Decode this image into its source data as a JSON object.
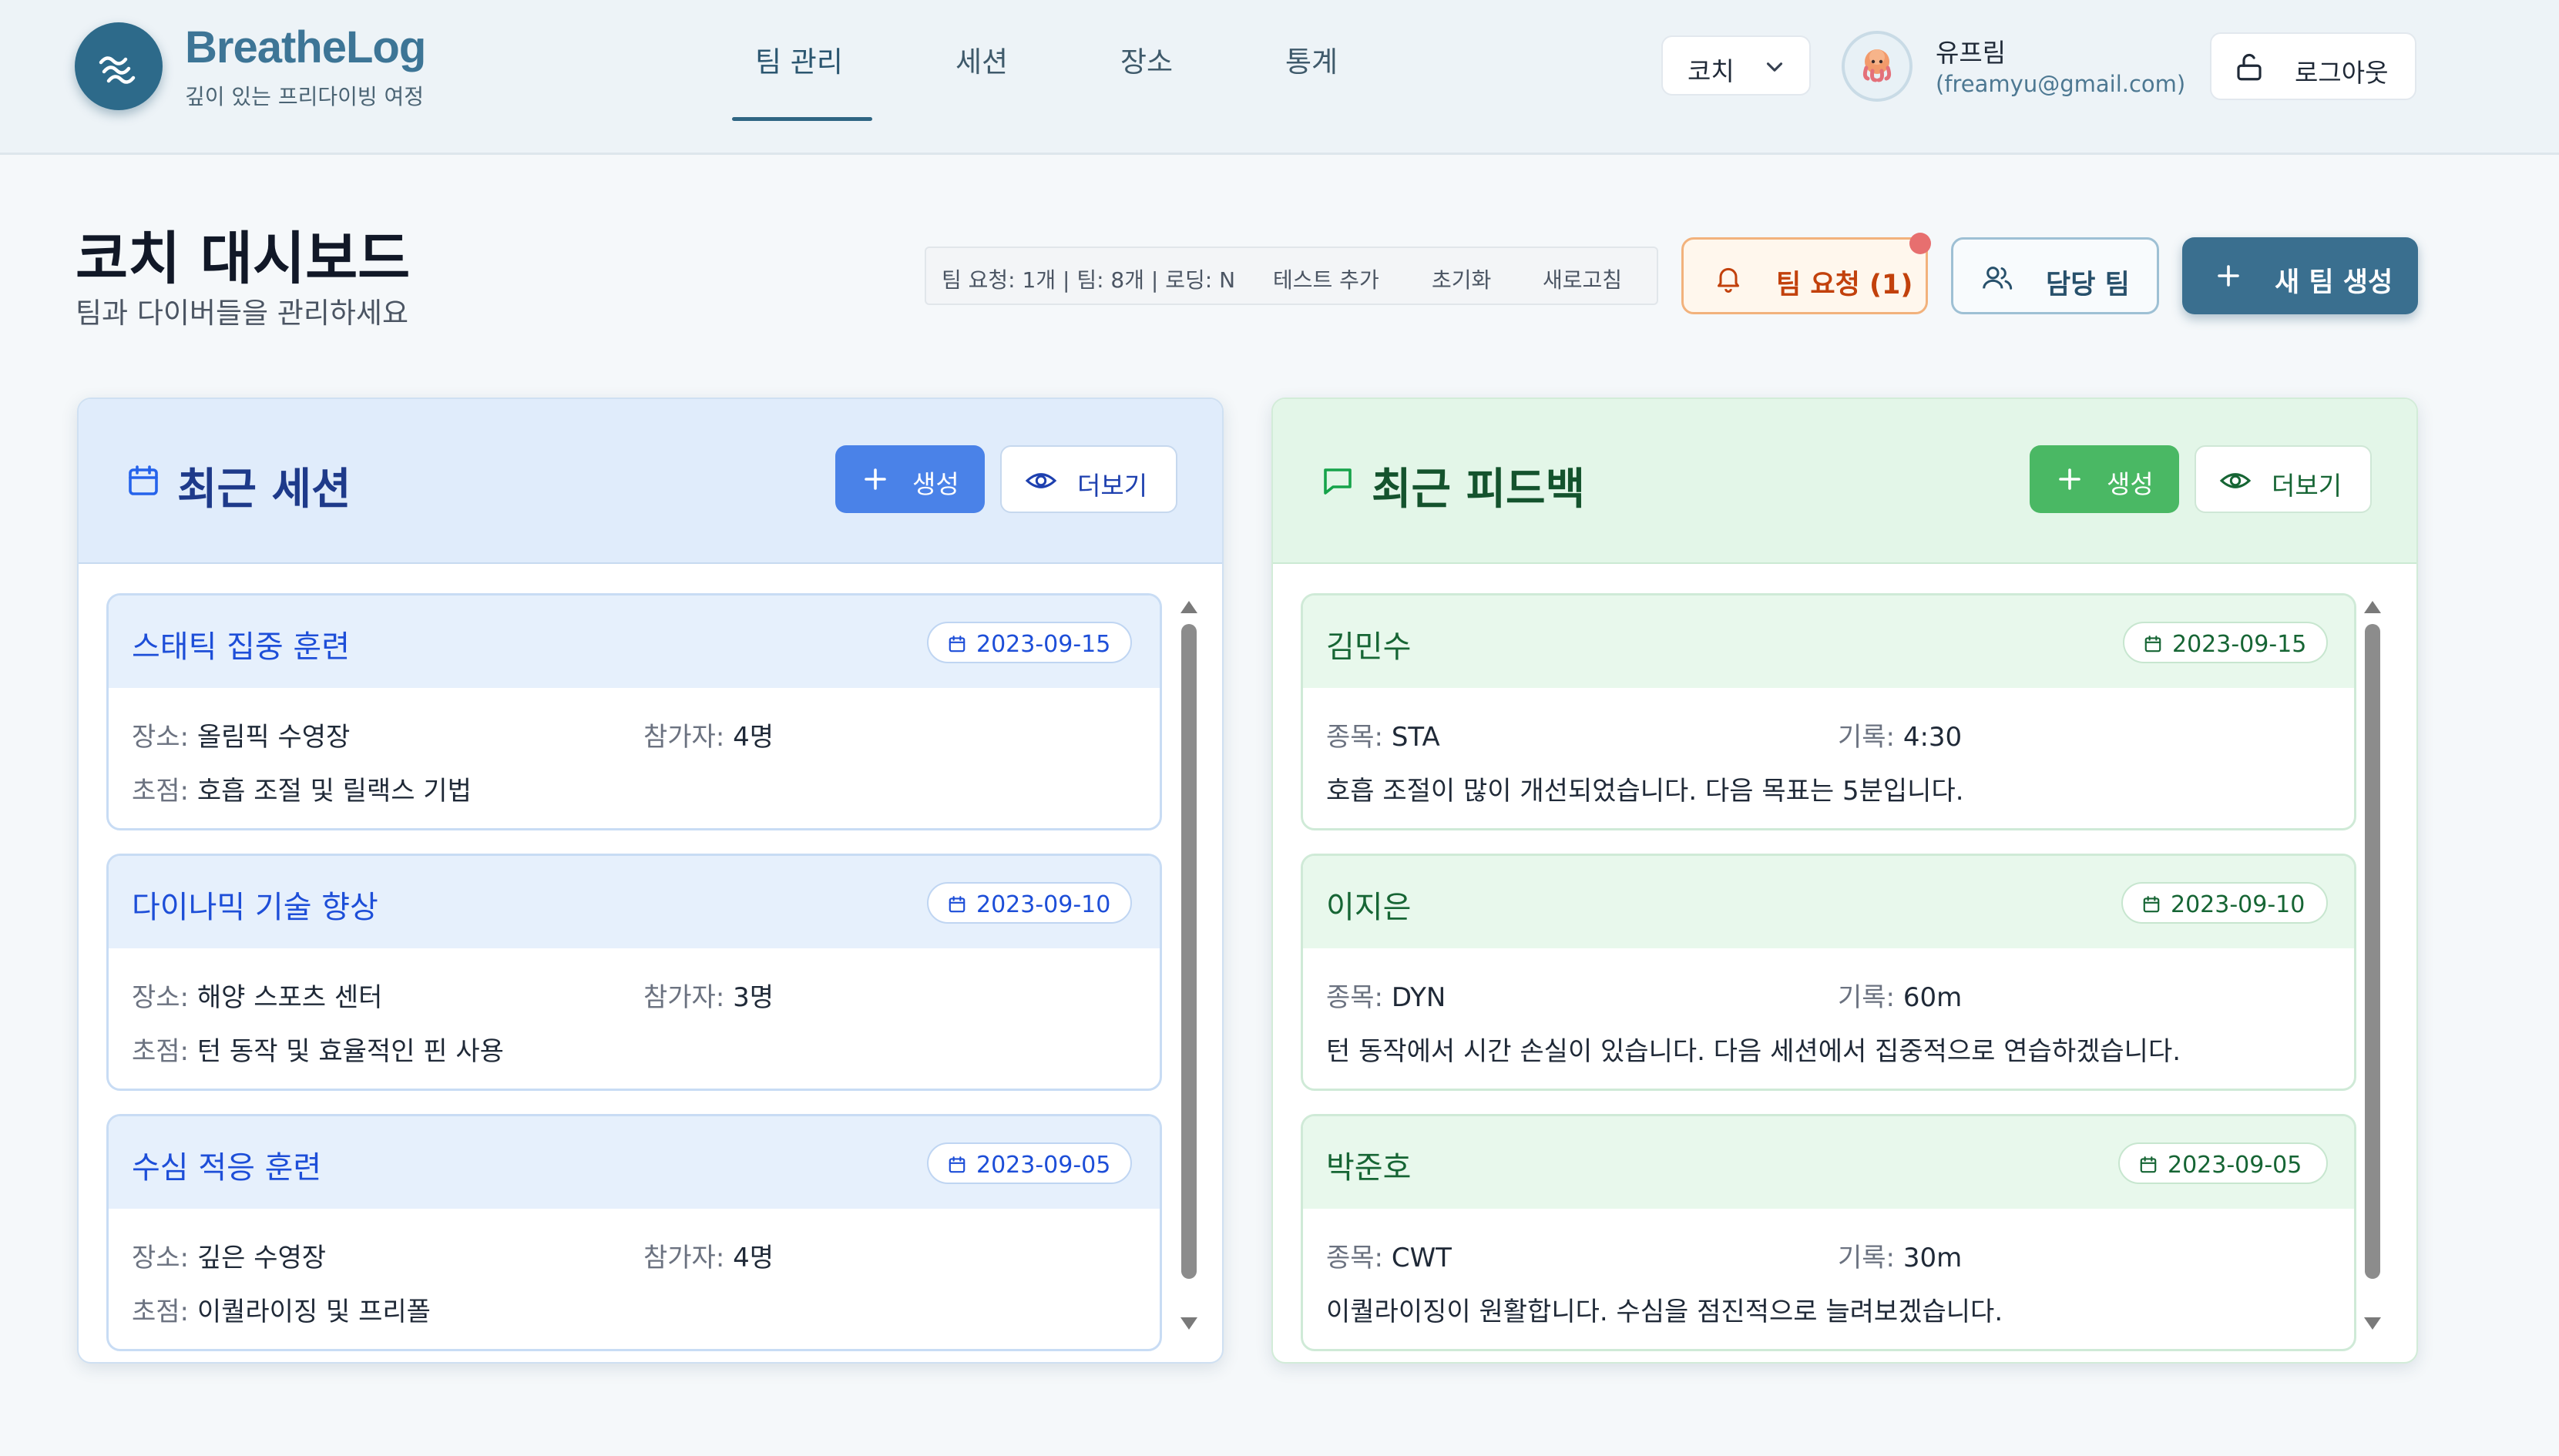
{
  "brand": {
    "name": "BreatheLog",
    "tagline": "깊이 있는 프리다이빙 여정"
  },
  "nav": {
    "items": [
      "팀 관리",
      "세션",
      "장소",
      "통계"
    ],
    "active": "팀 관리"
  },
  "role_select": {
    "value": "코치"
  },
  "user": {
    "name": "유프림",
    "email": "(freamyu@gmail.com)"
  },
  "logout": {
    "label": "로그아웃"
  },
  "page": {
    "title": "코치 대시보드",
    "subtitle": "팀과 다이버들을 관리하세요"
  },
  "debug": {
    "status": "팀 요청: 1개 | 팀: 8개 | 로딩: N",
    "buttons": [
      "테스트 추가",
      "초기화",
      "새로고침"
    ]
  },
  "actions": {
    "team_requests": "팀 요청 (1)",
    "my_teams": "담당 팀",
    "new_team": "새 팀 생성"
  },
  "sessions_panel": {
    "title": "최근 세션",
    "create_label": "생성",
    "more_label": "더보기",
    "key_location": "장소:",
    "key_participants": "참가자:",
    "key_focus": "초점:",
    "items": [
      {
        "title": "스태틱 집중 훈련",
        "date": "2023-09-15",
        "location": "올림픽 수영장",
        "participants": "4명",
        "focus": "호흡 조절 및 릴랙스 기법"
      },
      {
        "title": "다이나믹 기술 향상",
        "date": "2023-09-10",
        "location": "해양 스포츠 센터",
        "participants": "3명",
        "focus": "턴 동작 및 효율적인 핀 사용"
      },
      {
        "title": "수심 적응 훈련",
        "date": "2023-09-05",
        "location": "깊은 수영장",
        "participants": "4명",
        "focus": "이퀄라이징 및 프리폴"
      }
    ]
  },
  "feedback_panel": {
    "title": "최근 피드백",
    "create_label": "생성",
    "more_label": "더보기",
    "key_discipline": "종목:",
    "key_record": "기록:",
    "items": [
      {
        "name": "김민수",
        "date": "2023-09-15",
        "discipline": "STA",
        "record": "4:30",
        "comment": "호흡 조절이 많이 개선되었습니다. 다음 목표는 5분입니다."
      },
      {
        "name": "이지은",
        "date": "2023-09-10",
        "discipline": "DYN",
        "record": "60m",
        "comment": "턴 동작에서 시간 손실이 있습니다. 다음 세션에서 집중적으로 연습하겠습니다."
      },
      {
        "name": "박준호",
        "date": "2023-09-05",
        "discipline": "CWT",
        "record": "30m",
        "comment": "이퀄라이징이 원활합니다. 수심을 점진적으로 늘려보겠습니다."
      }
    ]
  },
  "icons": {
    "logo": "wave-icon",
    "role_chevron": "chevron-down-icon",
    "logout": "unlock-icon",
    "requests": "bell-icon",
    "teams": "users-icon",
    "add": "plus-icon",
    "sessions": "calendar-icon",
    "feedback": "message-icon",
    "more": "eye-icon"
  },
  "colors": {
    "brand": "#3d7596",
    "sessions_accent": "#1d4ed8",
    "feedback_accent": "#166534",
    "request_accent": "#c2410c",
    "new_team_bg": "#3a6f8f"
  }
}
